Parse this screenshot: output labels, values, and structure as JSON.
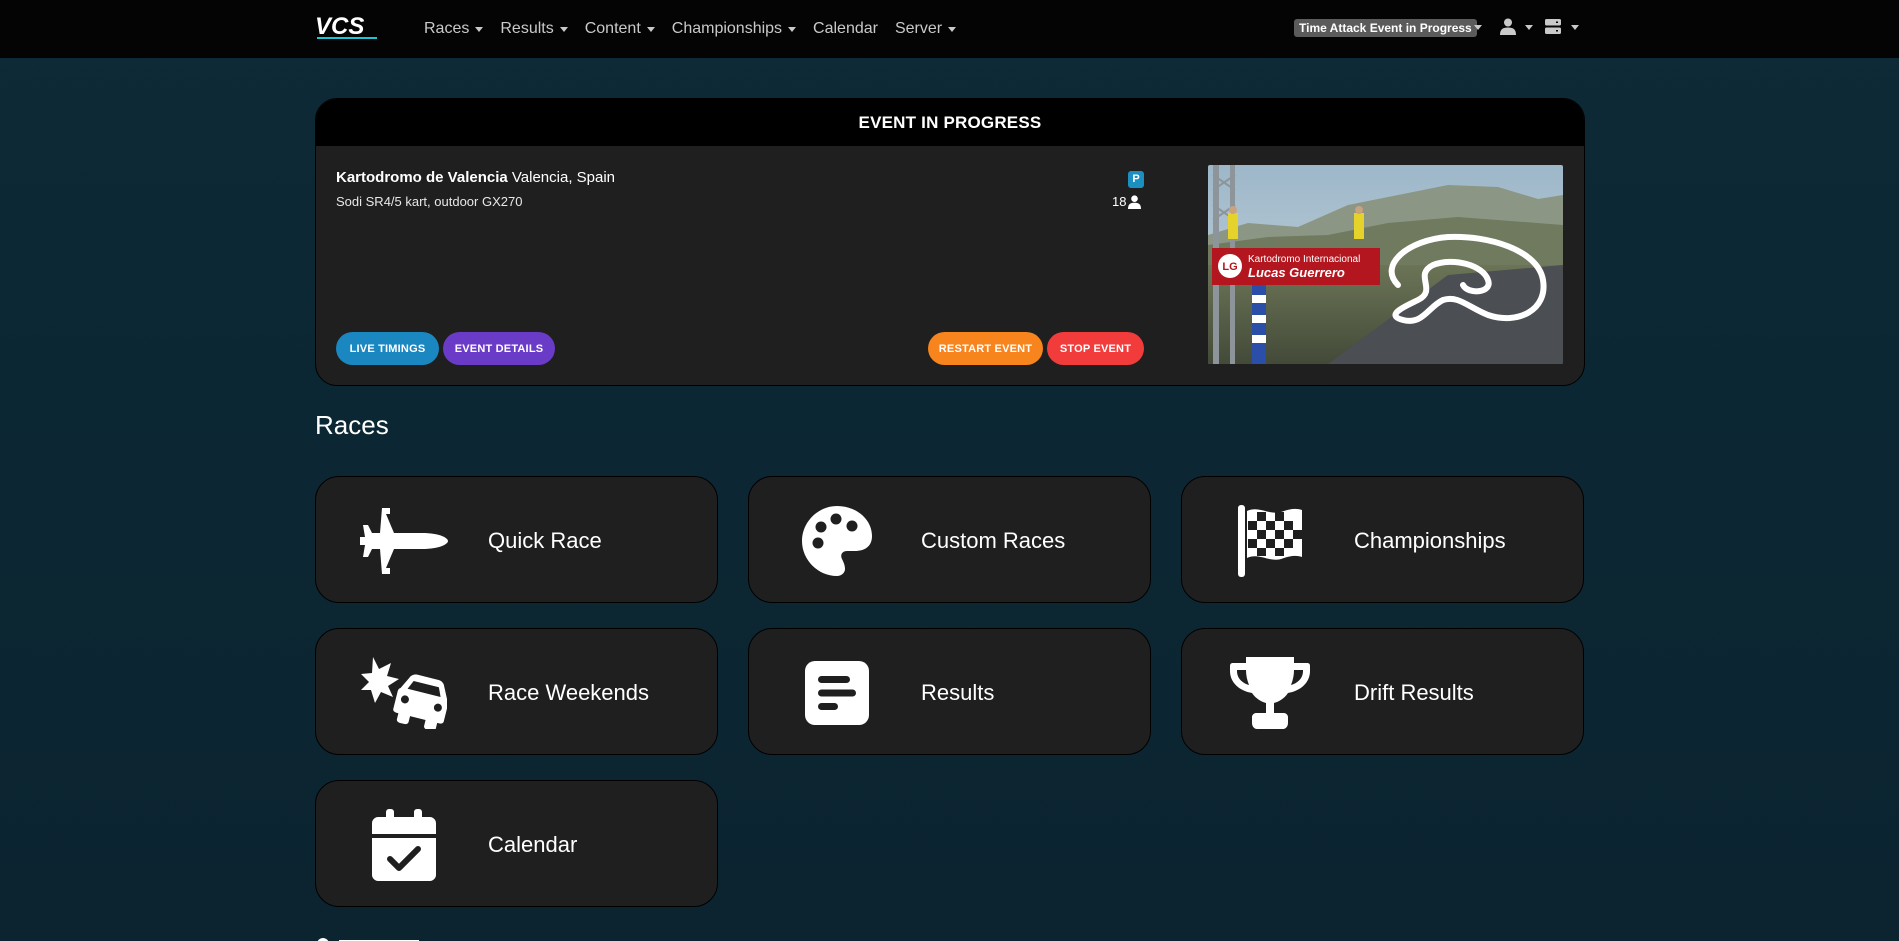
{
  "nav": {
    "logo_text": "VCS",
    "items": [
      {
        "label": "Races",
        "dropdown": true
      },
      {
        "label": "Results",
        "dropdown": true
      },
      {
        "label": "Content",
        "dropdown": true
      },
      {
        "label": "Championships",
        "dropdown": true
      },
      {
        "label": "Calendar",
        "dropdown": false
      },
      {
        "label": "Server",
        "dropdown": true
      }
    ],
    "status": "Time Attack Event in Progress"
  },
  "event": {
    "header": "EVENT IN PROGRESS",
    "track_name": "Kartodromo de Valencia",
    "track_location": "Valencia, Spain",
    "cars": "Sodi SR4/5 kart, outdoor GX270",
    "session_badge": "P",
    "driver_count": "18",
    "buttons": {
      "live": "LIVE TIMINGS",
      "details": "EVENT DETAILS",
      "restart": "RESTART EVENT",
      "stop": "STOP EVENT"
    },
    "image": {
      "banner_line1": "Kartodromo Internacional",
      "banner_line2": "Lucas Guerrero",
      "banner_logo": "LG"
    }
  },
  "races": {
    "title": "Races",
    "tiles": [
      {
        "label": "Quick Race",
        "icon": "jet-icon"
      },
      {
        "label": "Custom Races",
        "icon": "palette-icon"
      },
      {
        "label": "Championships",
        "icon": "checkered-flag-icon"
      },
      {
        "label": "Race Weekends",
        "icon": "car-crash-icon"
      },
      {
        "label": "Results",
        "icon": "results-icon"
      },
      {
        "label": "Drift Results",
        "icon": "trophy-icon"
      },
      {
        "label": "Calendar",
        "icon": "calendar-check-icon"
      }
    ]
  },
  "colors": {
    "live": "#1b87c0",
    "details": "#6a3bc7",
    "restart": "#f7841c",
    "stop": "#f23b3b",
    "session_badge": "#1a8fc0",
    "logo_accent": "#19c6d9"
  }
}
